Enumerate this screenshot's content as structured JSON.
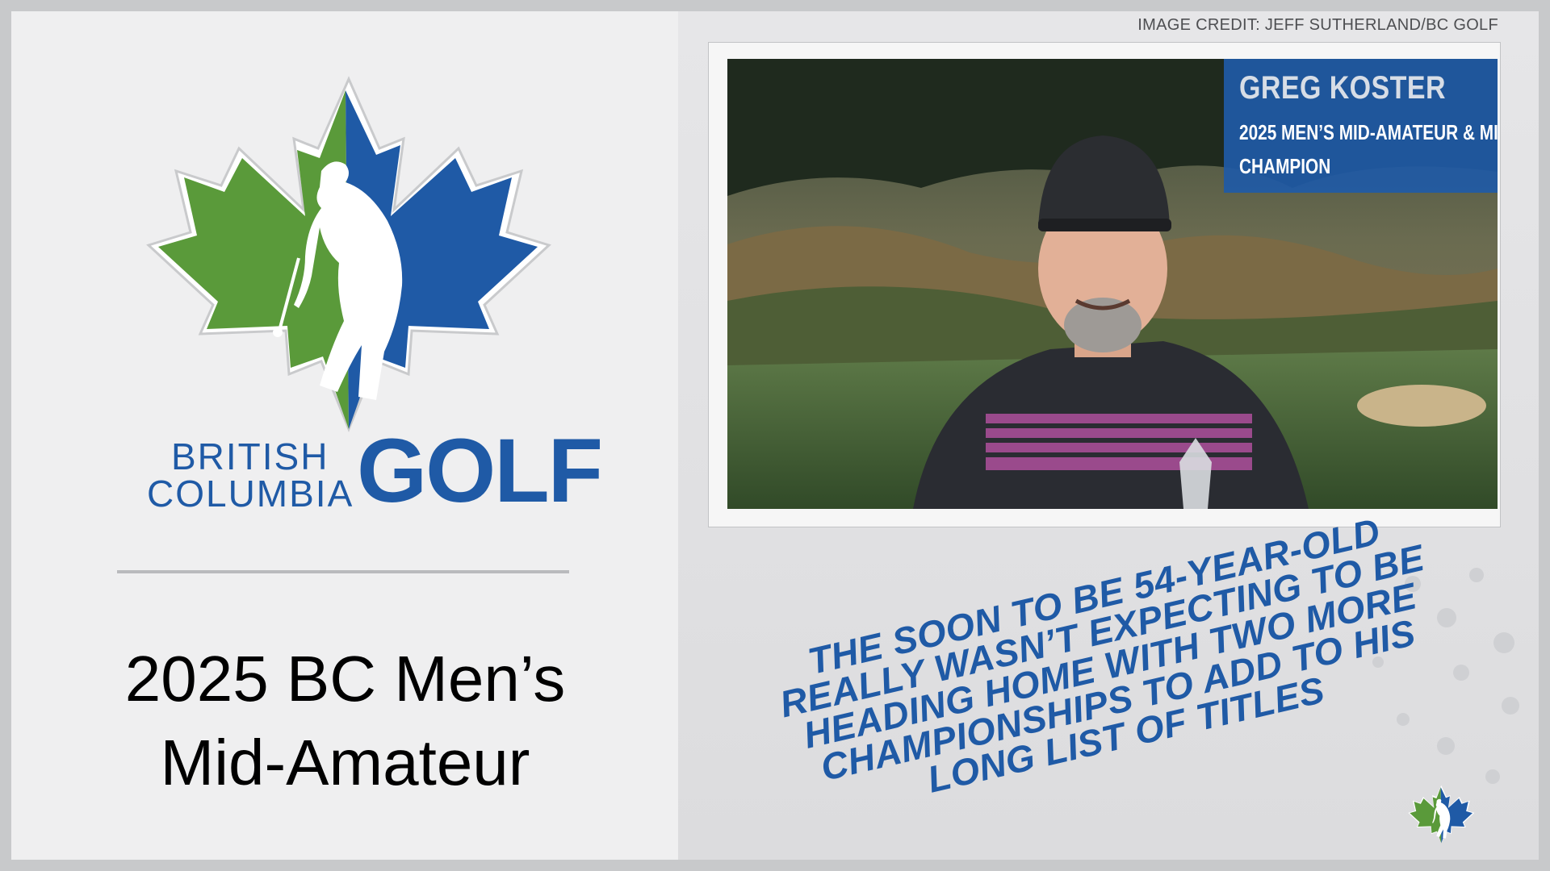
{
  "logo": {
    "line1": "BRITISH",
    "line2": "COLUMBIA",
    "golf": "GOLF",
    "colors": {
      "blue": "#1f5aa6",
      "green": "#5a9a3a"
    }
  },
  "event_title": {
    "line1": "2025 BC Men’s",
    "line2": "Mid-Amateur"
  },
  "image_credit": "IMAGE CREDIT: JEFF SUTHERLAND/BC GOLF",
  "photo_banner": {
    "name": "GREG KOSTER",
    "line2": "2025 MEN’S MID-AMATEUR & MI",
    "line3": "CHAMPION"
  },
  "quote": {
    "lines": [
      "THE SOON TO BE 54-YEAR-OLD",
      "REALLY WASN’T EXPECTING TO BE",
      "HEADING HOME WITH TWO MORE",
      "CHAMPIONSHIPS TO ADD TO HIS",
      "LONG LIST OF TITLES"
    ]
  }
}
